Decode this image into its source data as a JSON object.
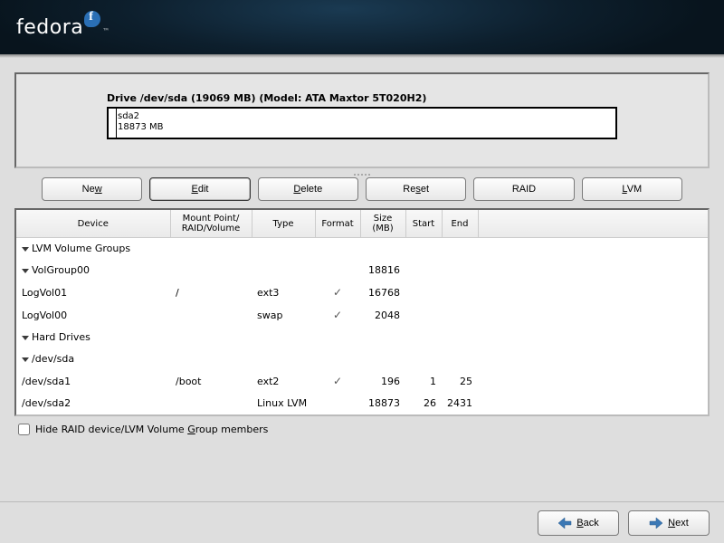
{
  "brand": "fedora",
  "drive": {
    "title": "Drive /dev/sda (19069 MB) (Model: ATA Maxtor 5T020H2)",
    "part2_name": "sda2",
    "part2_size": "18873 MB"
  },
  "toolbar": {
    "new": "New",
    "edit": "Edit",
    "delete": "Delete",
    "reset": "Reset",
    "raid": "RAID",
    "lvm": "LVM"
  },
  "columns": {
    "device": "Device",
    "mount": "Mount Point/\nRAID/Volume",
    "type": "Type",
    "format": "Format",
    "size": "Size\n(MB)",
    "start": "Start",
    "end": "End"
  },
  "rows": {
    "lvm_groups": "LVM Volume Groups",
    "volgroup": "VolGroup00",
    "volgroup_size": "18816",
    "lv01": "LogVol01",
    "lv01_mount": "/",
    "lv01_type": "ext3",
    "lv01_size": "16768",
    "lv00": "LogVol00",
    "lv00_type": "swap",
    "lv00_size": "2048",
    "hd": "Hard Drives",
    "sda": "/dev/sda",
    "sda1": "/dev/sda1",
    "sda1_mount": "/boot",
    "sda1_type": "ext2",
    "sda1_size": "196",
    "sda1_start": "1",
    "sda1_end": "25",
    "sda2": "/dev/sda2",
    "sda2_type": "Linux LVM",
    "sda2_size": "18873",
    "sda2_start": "26",
    "sda2_end": "2431"
  },
  "checkbox_label": "Hide RAID device/LVM Volume Group members",
  "nav": {
    "back": "Back",
    "next": "Next"
  }
}
